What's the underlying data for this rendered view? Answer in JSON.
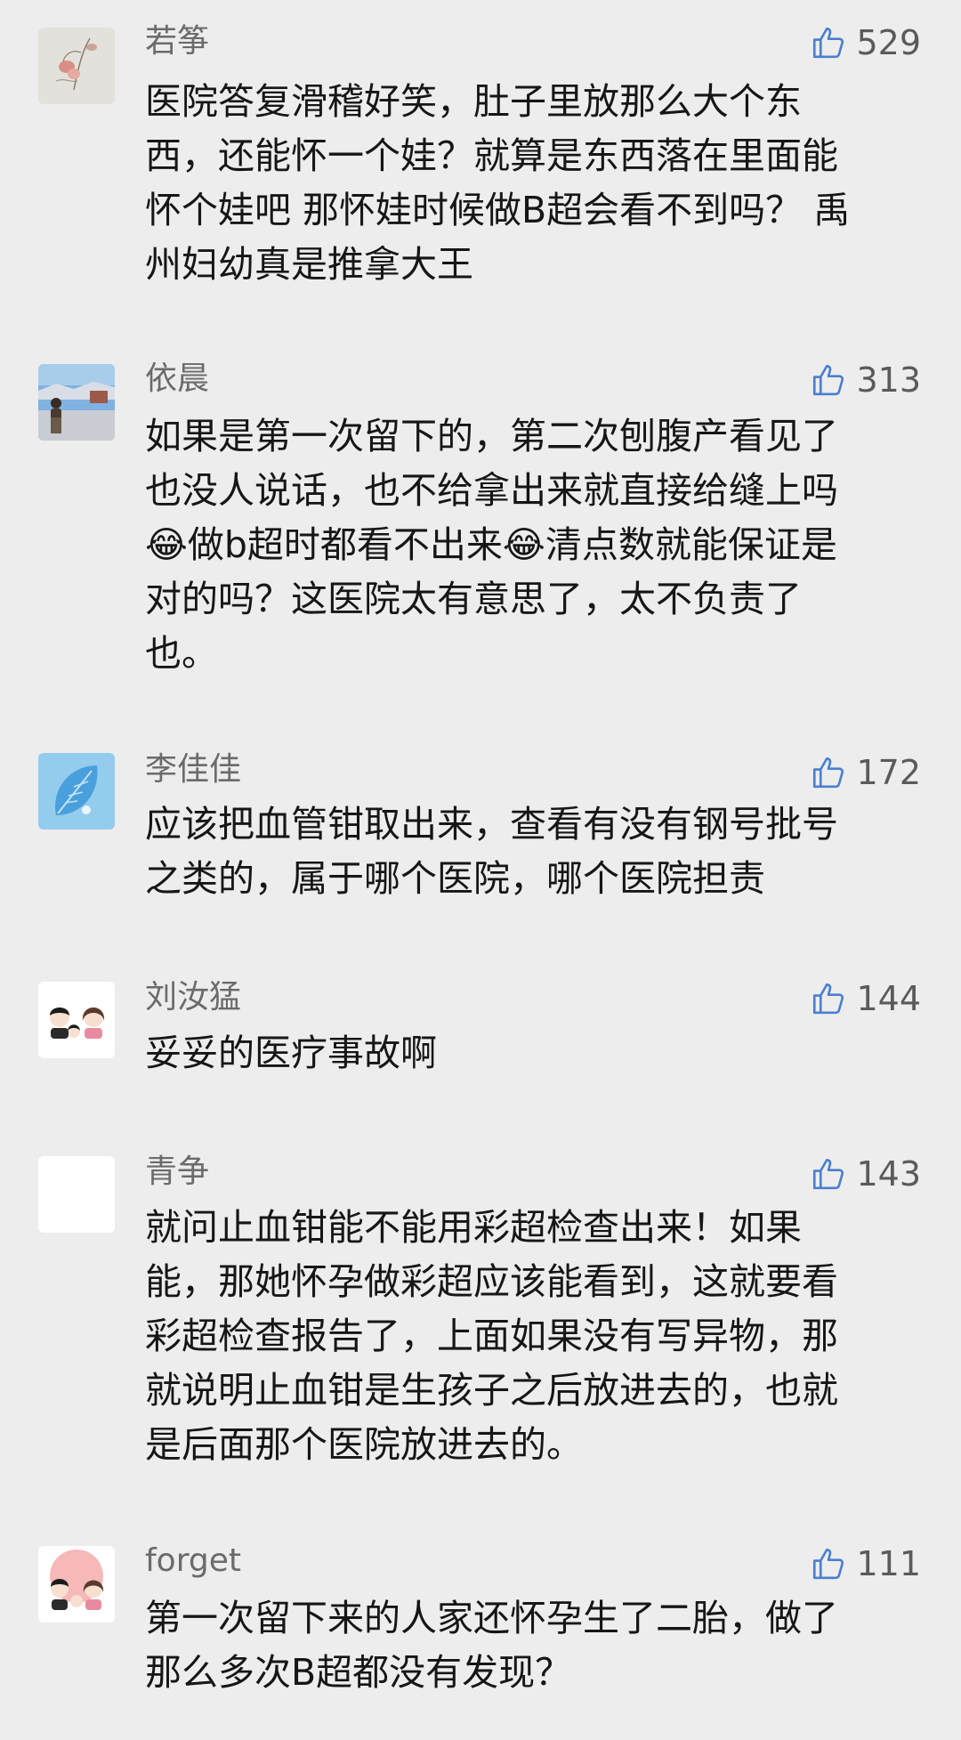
{
  "comments": [
    {
      "username": "若筝",
      "likes": "529",
      "text": "医院答复滑稽好笑，肚子里放那么大个东\n西，还能怀一个娃？就算是东西落在里面能\n怀个娃吧 那怀娃时候做B超会看不到吗？ 禹\n州妇幼真是推拿大王",
      "avatar_icon": "flower-sketch-avatar"
    },
    {
      "username": "依晨",
      "likes": "313",
      "text": "如果是第一次留下的，第二次刨腹产看见了\n也没人说话，也不给拿出来就直接给缝上吗\n😂做b超时都看不出来😂清点数就能保证是\n对的吗？这医院太有意思了，太不负责了\n也。",
      "avatar_icon": "person-landscape-avatar"
    },
    {
      "username": "李佳佳",
      "likes": "172",
      "text": "应该把血管钳取出来，查看有没有钢号批号\n之类的，属于哪个医院，哪个医院担责",
      "avatar_icon": "blue-leaf-avatar"
    },
    {
      "username": "刘汝猛",
      "likes": "144",
      "text": "妥妥的医疗事故啊",
      "avatar_icon": "cartoon-family-avatar"
    },
    {
      "username": "青争",
      "likes": "143",
      "text": "就问止血钳能不能用彩超检查出来！如果\n能，那她怀孕做彩超应该能看到，这就要看\n彩超检查报告了，上面如果没有写异物，那\n就说明止血钳是生孩子之后放进去的，也就\n是后面那个医院放进去的。",
      "avatar_icon": "blank-avatar"
    },
    {
      "username": "forget",
      "likes": "111",
      "text": "第一次留下来的人家还怀孕生了二胎，做了\n那么多次B超都没有发现？",
      "avatar_icon": "pink-cartoon-family-avatar"
    }
  ]
}
